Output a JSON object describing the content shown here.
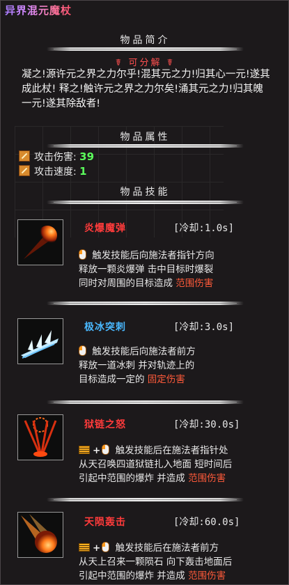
{
  "title": "异界混元魔杖",
  "sections": {
    "intro": "物品简介",
    "attributes": "物品属性",
    "skills": "物品技能"
  },
  "decomposable": "☤ 可分解 ☤",
  "description": "凝之!源许元之界之力尔乎!混其元之力!归其心一元!遂其成此杖! 释之!触许元之界之力尔矣!涌其元之力!归其魄一元!遂其除敌者!",
  "stats": [
    {
      "label": "攻击伤害:",
      "value": "39",
      "icon": "sword-icon"
    },
    {
      "label": "攻击速度:",
      "value": "1",
      "icon": "speed-icon"
    }
  ],
  "skills": [
    {
      "name": "炎爆魔弹",
      "name_color": "#ff3b3b",
      "cooldown": "[冷却:1.0s]",
      "icon": "fireball-icon",
      "input": "mouse",
      "desc1": "触发技能后向施法者指针方向",
      "desc2": "释放一颗炎爆弹 击中目标时爆裂",
      "desc3": "同时对周围的目标造成",
      "damage": "范围伤害"
    },
    {
      "name": "极冰突刺",
      "name_color": "#49b8ff",
      "cooldown": "[冷却:3.0s]",
      "icon": "ice-spike-icon",
      "input": "mouse",
      "desc1": "触发技能后向施法者前方",
      "desc2": "释放一道冰刺 并对轨迹上的",
      "desc3": "目标造成一定的",
      "damage": "固定伤害"
    },
    {
      "name": "狱链之怒",
      "name_color": "#ff3b3b",
      "cooldown": "[冷却:30.0s]",
      "icon": "hell-chain-icon",
      "input": "keyboard+mouse",
      "desc1": "触发技能后在施法者指针处",
      "desc2": "从天召唤四道狱链扎入地面 短时间后",
      "desc3": "引起中范围的爆炸 并造成",
      "damage": "范围伤害"
    },
    {
      "name": "天陨轰击",
      "name_color": "#ff3b3b",
      "cooldown": "[冷却:60.0s]",
      "icon": "meteor-icon",
      "input": "keyboard+mouse",
      "desc1": "触发技能后在施法者前方",
      "desc2": "从天上召来一颗陨石 向下轰击地面后",
      "desc3": "引起中范围的爆炸 并造成",
      "damage": "范围伤害"
    }
  ]
}
